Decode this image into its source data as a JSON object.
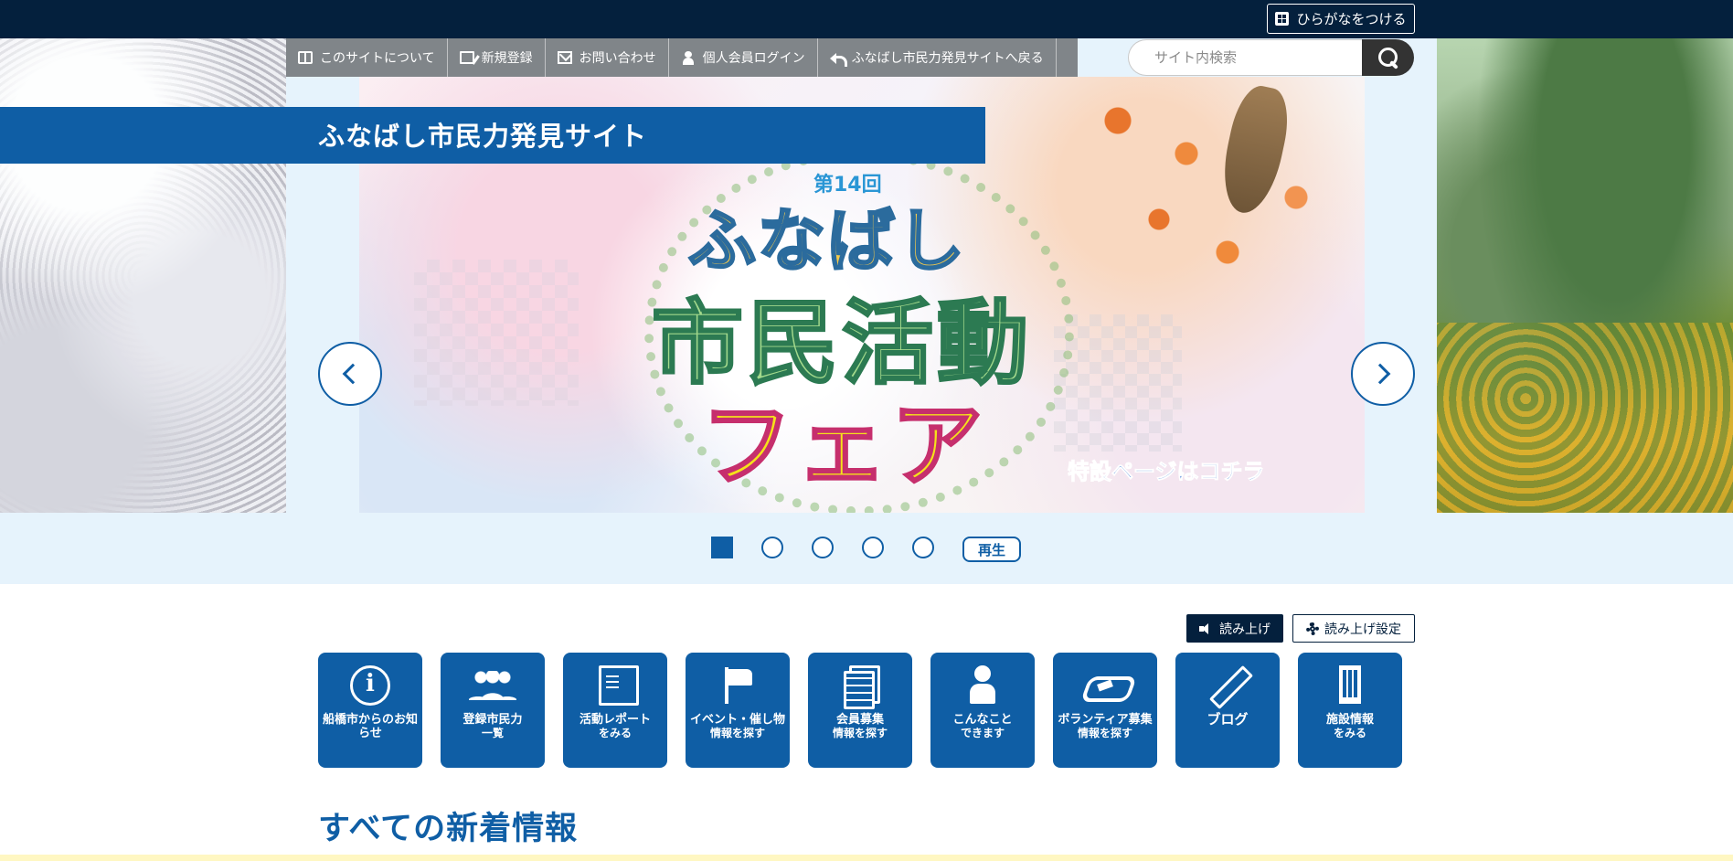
{
  "topbar": {
    "furigana_label": "ひらがなをつける"
  },
  "nav": {
    "items": [
      {
        "label": "このサイトについて",
        "icon": "book-icon"
      },
      {
        "label": "新規登録",
        "icon": "register-icon"
      },
      {
        "label": "お問い合わせ",
        "icon": "mail-icon"
      },
      {
        "label": "個人会員ログイン",
        "icon": "user-icon"
      },
      {
        "label": "ふなばし市民力発見サイトへ戻る",
        "icon": "back-arrow-icon"
      }
    ]
  },
  "search": {
    "placeholder": "サイト内検索"
  },
  "site": {
    "title": "ふなばし市民力発見サイト"
  },
  "slider": {
    "slide": {
      "edition": "第14回",
      "line1": "ふなばし",
      "line2": "市民活動",
      "line3": "フェア",
      "link": "特設ページはコチラ"
    },
    "dot_count": 5,
    "active_index": 0,
    "play_label": "再生"
  },
  "read_aloud": {
    "read_label": "読み上げ",
    "settings_label": "読み上げ設定"
  },
  "tiles": [
    {
      "label": "船橋市からのお知らせ",
      "sub": "",
      "icon": "info-icon"
    },
    {
      "label": "登録市民力",
      "sub": "一覧",
      "icon": "people-icon"
    },
    {
      "label": "活動レポート",
      "sub": "をみる",
      "icon": "document-icon"
    },
    {
      "label": "イベント・催し物",
      "sub": "情報を探す",
      "icon": "flag-icon"
    },
    {
      "label": "会員募集",
      "sub": "情報を探す",
      "icon": "documents-icon"
    },
    {
      "label": "こんなこと",
      "sub": "できます",
      "icon": "person-icon"
    },
    {
      "label": "ボランティア募集",
      "sub": "情報を探す",
      "icon": "handshake-icon"
    },
    {
      "label": "ブログ",
      "sub": "",
      "icon": "pencil-icon"
    },
    {
      "label": "施設情報",
      "sub": "をみる",
      "icon": "building-icon"
    }
  ],
  "news": {
    "title": "すべての新着情報"
  },
  "colors": {
    "primary": "#0f5ea5",
    "dark": "#04203d",
    "light_bg": "#e6f3fc"
  }
}
